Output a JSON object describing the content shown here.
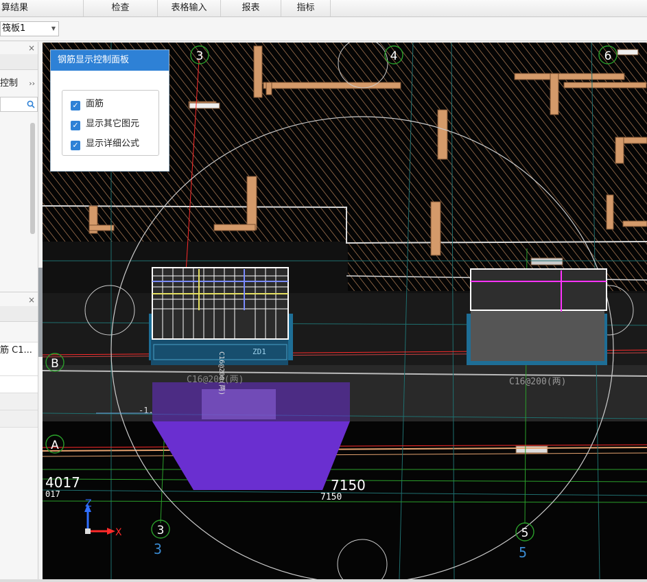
{
  "menus": [
    "算结果",
    "检查",
    "表格输入",
    "报表",
    "指标"
  ],
  "floor_select": {
    "value": "筏板1"
  },
  "left_panel": {
    "top_close": "×",
    "tab_label": "控制",
    "tab_more": "››",
    "search_icon": "search-icon",
    "bottom_close": "×",
    "row_text": "筋 C1..."
  },
  "control_panel": {
    "title": "钢筋显示控制面板",
    "options": [
      {
        "label": "面筋",
        "checked": true
      },
      {
        "label": "显示其它图元",
        "checked": true
      },
      {
        "label": "显示详细公式",
        "checked": true
      }
    ]
  },
  "axes": {
    "top": [
      "3",
      "4",
      "6"
    ],
    "bottom": [
      "3",
      "5"
    ],
    "left": [
      "B",
      "A"
    ]
  },
  "dimensions": {
    "d1": "4017",
    "d1_sub": "017",
    "d2": "7150",
    "d2_sub": "7150"
  },
  "annotations": {
    "zd_label": "ZD1",
    "rebar_text": "C16@200(两)",
    "rebar_text2": "C16@200(两)",
    "level_text": "-1."
  },
  "coord_axes": {
    "z": "Z",
    "x": "X"
  },
  "colors": {
    "accent": "#2e81d6",
    "viewport_bg": "#050505",
    "hatch": "#e6a470",
    "axis_circle": "#2aa02a",
    "purple": "#6a2fd0",
    "magenta": "#ff33ff"
  }
}
